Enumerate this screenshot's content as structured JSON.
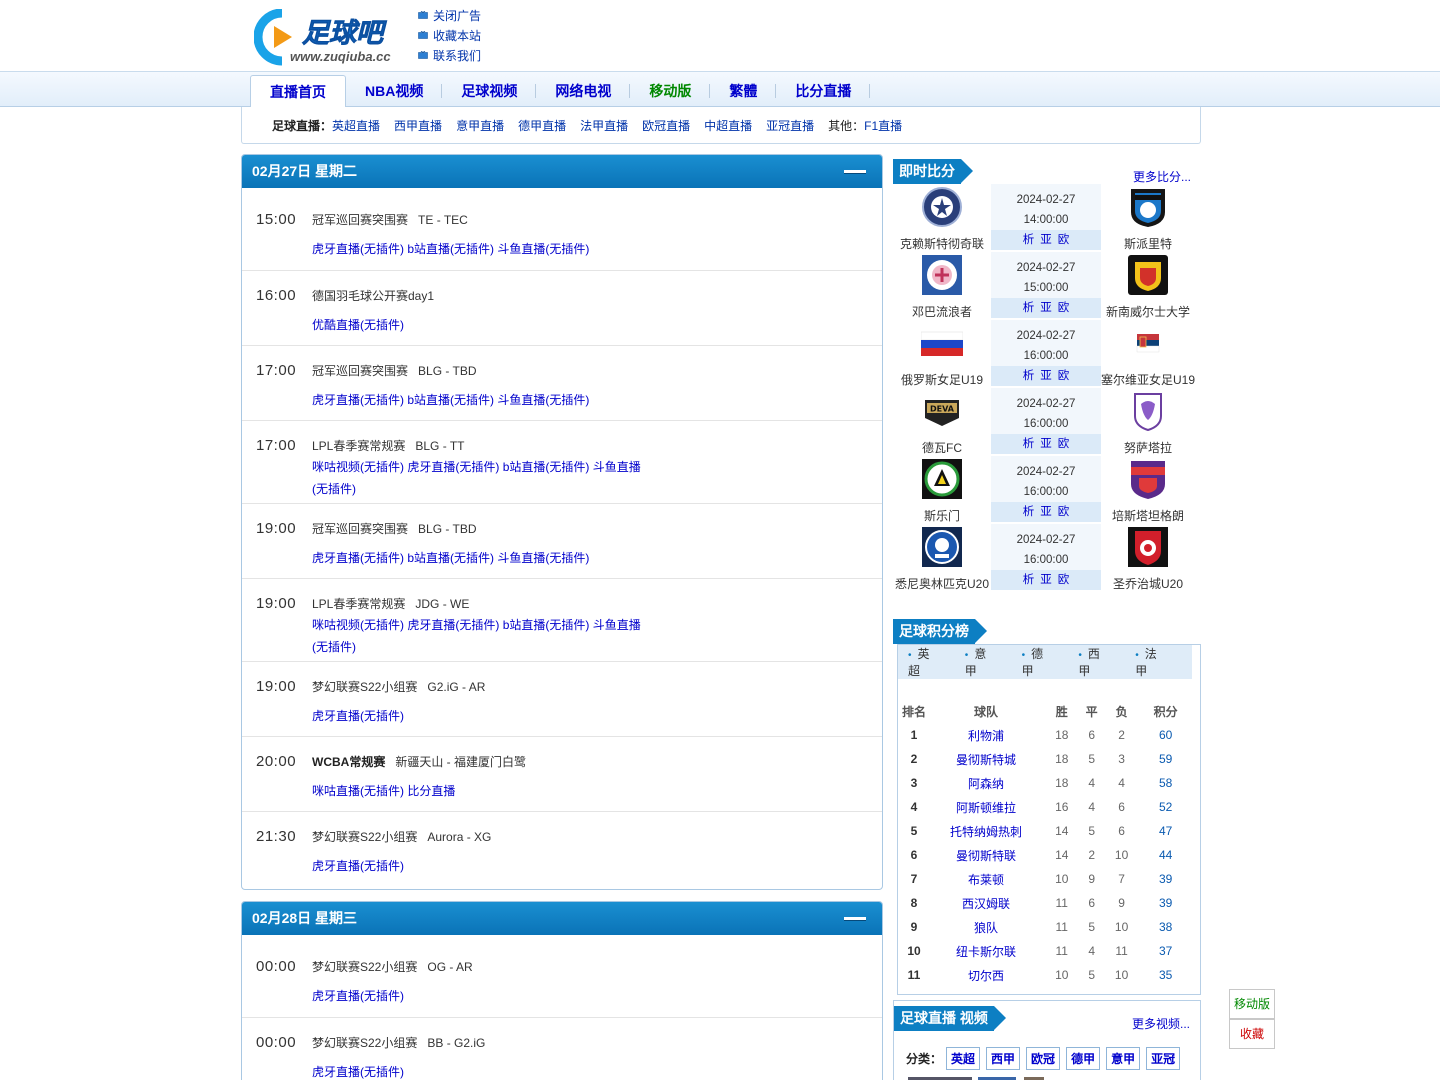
{
  "header": {
    "logo_url_text": "www.zuqiuba.cc",
    "links": [
      "关闭广告",
      "收藏本站",
      "联系我们"
    ]
  },
  "nav": {
    "items": [
      {
        "label": "直播首页",
        "active": true
      },
      {
        "label": "NBA视频"
      },
      {
        "label": "足球视频"
      },
      {
        "label": "网络电视"
      },
      {
        "label": "移动版",
        "green": true
      },
      {
        "label": "繁體"
      },
      {
        "label": "比分直播"
      }
    ]
  },
  "subnav": {
    "label": "足球直播",
    "links": [
      "英超直播",
      "西甲直播",
      "意甲直播",
      "德甲直播",
      "法甲直播",
      "欧冠直播",
      "中超直播",
      "亚冠直播"
    ],
    "other_label": "其他：",
    "other_link": "F1直播"
  },
  "days": [
    {
      "title": "02月27日 星期二",
      "games": [
        {
          "time": "15:00",
          "league": "冠军巡回赛突围赛",
          "match": "TE - TEC",
          "links": [
            "虎牙直播(无插件)",
            "b站直播(无插件)",
            "斗鱼直播(无插件)"
          ]
        },
        {
          "time": "16:00",
          "league": "德国羽毛球公开赛day1",
          "match": "",
          "links": [
            "优酷直播(无插件)"
          ]
        },
        {
          "time": "17:00",
          "league": "冠军巡回赛突围赛",
          "match": "BLG - TBD",
          "links": [
            "虎牙直播(无插件)",
            "b站直播(无插件)",
            "斗鱼直播(无插件)"
          ]
        },
        {
          "time": "17:00",
          "league": "LPL春季赛常规赛",
          "match": "BLG - TT",
          "links": [
            "咪咕视频(无插件)",
            "虎牙直播(无插件)",
            "b站直播(无插件)",
            "斗鱼直播(无插件)"
          ]
        },
        {
          "time": "19:00",
          "league": "冠军巡回赛突围赛",
          "match": "BLG - TBD",
          "links": [
            "虎牙直播(无插件)",
            "b站直播(无插件)",
            "斗鱼直播(无插件)"
          ]
        },
        {
          "time": "19:00",
          "league": "LPL春季赛常规赛",
          "match": "JDG - WE",
          "links": [
            "咪咕视频(无插件)",
            "虎牙直播(无插件)",
            "b站直播(无插件)",
            "斗鱼直播(无插件)"
          ]
        },
        {
          "time": "19:00",
          "league": "梦幻联赛S22小组赛",
          "match": "G2.iG - AR",
          "links": [
            "虎牙直播(无插件)"
          ]
        },
        {
          "time": "20:00",
          "league": "WCBA常规赛",
          "match": "新疆天山 - 福建厦门白鹭",
          "bold": true,
          "links": [
            "咪咕直播(无插件)",
            "比分直播"
          ]
        },
        {
          "time": "21:30",
          "league": "梦幻联赛S22小组赛",
          "match": "Aurora - XG",
          "links": [
            "虎牙直播(无插件)"
          ]
        }
      ]
    },
    {
      "title": "02月28日 星期三",
      "games": [
        {
          "time": "00:00",
          "league": "梦幻联赛S22小组赛",
          "match": "OG - AR",
          "links": [
            "虎牙直播(无插件)"
          ]
        },
        {
          "time": "00:00",
          "league": "梦幻联赛S22小组赛",
          "match": "BB - G2.iG",
          "links": [
            "虎牙直播(无插件)"
          ]
        }
      ]
    }
  ],
  "live_scores": {
    "title": "即时比分",
    "more": "更多比分...",
    "odds": [
      "析",
      "亚",
      "欧"
    ],
    "matches": [
      {
        "home": "克赖斯特彻奇联",
        "away": "斯派里特",
        "date": "2024-02-27",
        "time": "14:00:00",
        "home_logo": "crest-navy",
        "away_logo": "crest-black-blue"
      },
      {
        "home": "邓巴流浪者",
        "away": "新南威尔士大学",
        "date": "2024-02-27",
        "time": "15:00:00",
        "home_logo": "crest-blue-pink",
        "away_logo": "crest-orange-black"
      },
      {
        "home": "俄罗斯女足U19",
        "away": "塞尔维亚女足U19",
        "date": "2024-02-27",
        "time": "16:00:00",
        "home_logo": "flag-russia",
        "away_logo": "flag-serbia"
      },
      {
        "home": "德瓦FC",
        "away": "努萨塔拉",
        "date": "2024-02-27",
        "time": "16:00:00",
        "home_logo": "crest-deva",
        "away_logo": "crest-purple"
      },
      {
        "home": "斯乐门",
        "away": "培斯塔坦格朗",
        "date": "2024-02-27",
        "time": "16:00:00",
        "home_logo": "crest-green-black",
        "away_logo": "crest-purple-red"
      },
      {
        "home": "悉尼奥林匹克U20",
        "away": "圣乔治城U20",
        "date": "2024-02-27",
        "time": "16:00:00",
        "home_logo": "crest-blue-white",
        "away_logo": "crest-red-black"
      }
    ]
  },
  "standings": {
    "title": "足球积分榜",
    "leagues": [
      "英超",
      "意甲",
      "德甲",
      "西甲",
      "法甲"
    ],
    "headers": [
      "排名",
      "球队",
      "胜",
      "平",
      "负",
      "积分"
    ],
    "rows": [
      [
        "1",
        "利物浦",
        "18",
        "6",
        "2",
        "60"
      ],
      [
        "2",
        "曼彻斯特城",
        "18",
        "5",
        "3",
        "59"
      ],
      [
        "3",
        "阿森纳",
        "18",
        "4",
        "4",
        "58"
      ],
      [
        "4",
        "阿斯顿维拉",
        "16",
        "4",
        "6",
        "52"
      ],
      [
        "5",
        "托特纳姆热刺",
        "14",
        "5",
        "6",
        "47"
      ],
      [
        "6",
        "曼彻斯特联",
        "14",
        "2",
        "10",
        "44"
      ],
      [
        "7",
        "布莱顿",
        "10",
        "9",
        "7",
        "39"
      ],
      [
        "8",
        "西汉姆联",
        "11",
        "6",
        "9",
        "39"
      ],
      [
        "9",
        "狼队",
        "11",
        "5",
        "10",
        "38"
      ],
      [
        "10",
        "纽卡斯尔联",
        "11",
        "4",
        "11",
        "37"
      ],
      [
        "11",
        "切尔西",
        "10",
        "5",
        "10",
        "35"
      ]
    ]
  },
  "video": {
    "title": "足球直播 视频",
    "more": "更多视频...",
    "cat_label": "分类：",
    "cats": [
      "英超",
      "西甲",
      "欧冠",
      "德甲",
      "意甲",
      "亚冠"
    ]
  },
  "float": {
    "mobile": "移动版",
    "fav": "收藏"
  },
  "colors": {
    "accent_blue": "#0d7fc3",
    "day_header": "#0a73b7",
    "link": "#0000cc",
    "mobile_green": "#008800"
  }
}
